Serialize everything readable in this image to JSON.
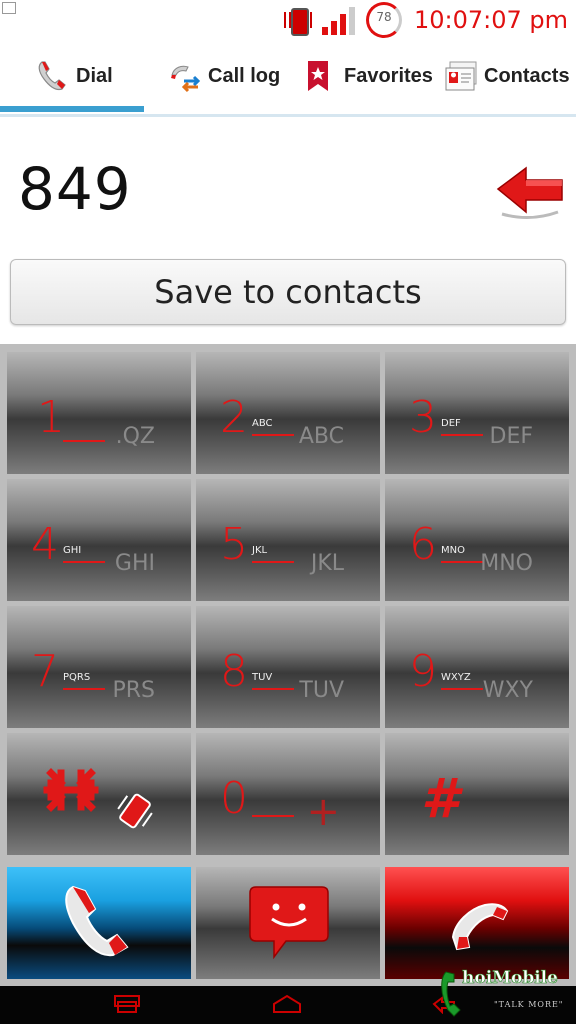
{
  "status_bar": {
    "time": "10:07:07 pm",
    "battery_level": "78"
  },
  "tabs": [
    {
      "label": "Dial",
      "icon": "phone-icon"
    },
    {
      "label": "Call log",
      "icon": "call-log-icon"
    },
    {
      "label": "Favorites",
      "icon": "star-bookmark-icon"
    },
    {
      "label": "Contacts",
      "icon": "contacts-card-icon"
    }
  ],
  "dialer": {
    "number": "849",
    "save_label": "Save to contacts"
  },
  "keys": [
    {
      "digit": "1",
      "small": "",
      "letters": ".QZ"
    },
    {
      "digit": "2",
      "small": "ABC",
      "letters": "ABC"
    },
    {
      "digit": "3",
      "small": "DEF",
      "letters": "DEF"
    },
    {
      "digit": "4",
      "small": "GHI",
      "letters": "GHI"
    },
    {
      "digit": "5",
      "small": "JKL",
      "letters": "JKL"
    },
    {
      "digit": "6",
      "small": "MNO",
      "letters": "MNO"
    },
    {
      "digit": "7",
      "small": "PQRS",
      "letters": "PRS"
    },
    {
      "digit": "8",
      "small": "TUV",
      "letters": "TUV"
    },
    {
      "digit": "9",
      "small": "WXYZ",
      "letters": "WXY"
    },
    {
      "digit": "*",
      "small": "",
      "letters": ""
    },
    {
      "digit": "0",
      "small": "",
      "letters": "+"
    },
    {
      "digit": "#",
      "small": "",
      "letters": ""
    }
  ],
  "colors": {
    "accent": "#e01818",
    "tab_indicator": "#3a9fd0",
    "call_blue": "#1aa0e0"
  },
  "watermark": {
    "text": "hoiMobile",
    "sub": "\"TALK MORE\""
  }
}
